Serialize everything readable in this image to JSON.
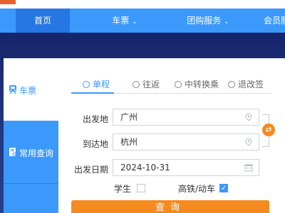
{
  "nav": {
    "items": [
      {
        "label": "首页",
        "has_dropdown": false,
        "active": true
      },
      {
        "label": "车票",
        "has_dropdown": true,
        "active": false
      },
      {
        "label": "团购服务",
        "has_dropdown": true,
        "active": false
      },
      {
        "label": "会员服",
        "has_dropdown": false,
        "active": false
      }
    ]
  },
  "sidebar": {
    "items": [
      {
        "label": "车票",
        "icon": "train-icon",
        "active": true
      },
      {
        "label": "常用查询",
        "icon": "search-doc-icon",
        "active": false
      }
    ]
  },
  "tabs": [
    {
      "label": "单程",
      "active": true
    },
    {
      "label": "往返",
      "active": false
    },
    {
      "label": "中转换乘",
      "active": false
    },
    {
      "label": "退改签",
      "active": false
    }
  ],
  "form": {
    "from_label": "出发地",
    "from_value": "广州",
    "to_label": "到达地",
    "to_value": "杭州",
    "date_label": "出发日期",
    "date_value": "2024-10-31",
    "student_label": "学生",
    "student_checked": false,
    "highspeed_label": "高铁/动车",
    "highspeed_checked": true,
    "query_label": "查询"
  },
  "colors": {
    "accent_blue": "#3b99fc",
    "accent_orange": "#f58a1f",
    "banner_navy": "#1a2a6e"
  }
}
